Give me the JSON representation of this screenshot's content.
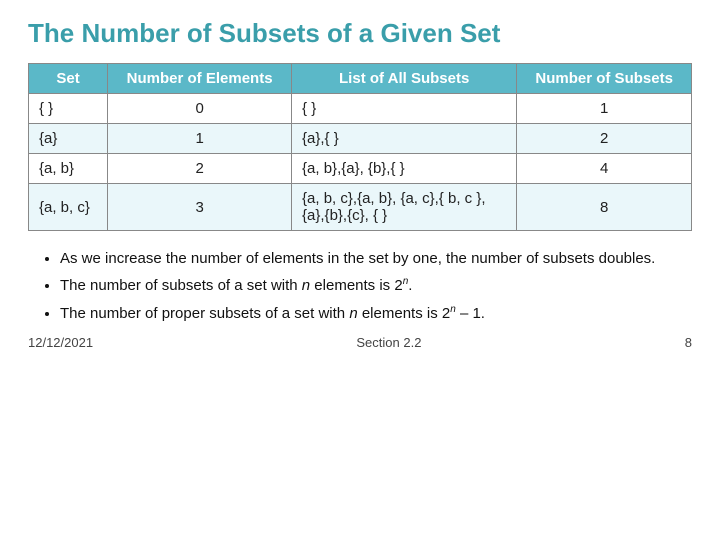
{
  "title": "The Number of Subsets of a Given Set",
  "table": {
    "headers": [
      "Set",
      "Number of Elements",
      "List of All Subsets",
      "Number of Subsets"
    ],
    "rows": [
      [
        "{ }",
        "0",
        "{ }",
        "1"
      ],
      [
        "{a}",
        "1",
        "{a},{ }",
        "2"
      ],
      [
        "{a, b}",
        "2",
        "{a, b},{a}, {b},{ }",
        "4"
      ],
      [
        "{a, b, c}",
        "3",
        "{a, b, c},{a, b}, {a, c},{ b, c }, {a},{b},{c}, { }",
        "8"
      ]
    ]
  },
  "bullets": [
    "As we increase the number of elements in the set by one, the number of subsets doubles.",
    "The number of subsets of a set with n elements is 2n.",
    "The number of proper subsets of a set with n elements is 2n – 1."
  ],
  "footer": {
    "date": "12/12/2021",
    "section": "Section 2.2",
    "page": "8"
  }
}
